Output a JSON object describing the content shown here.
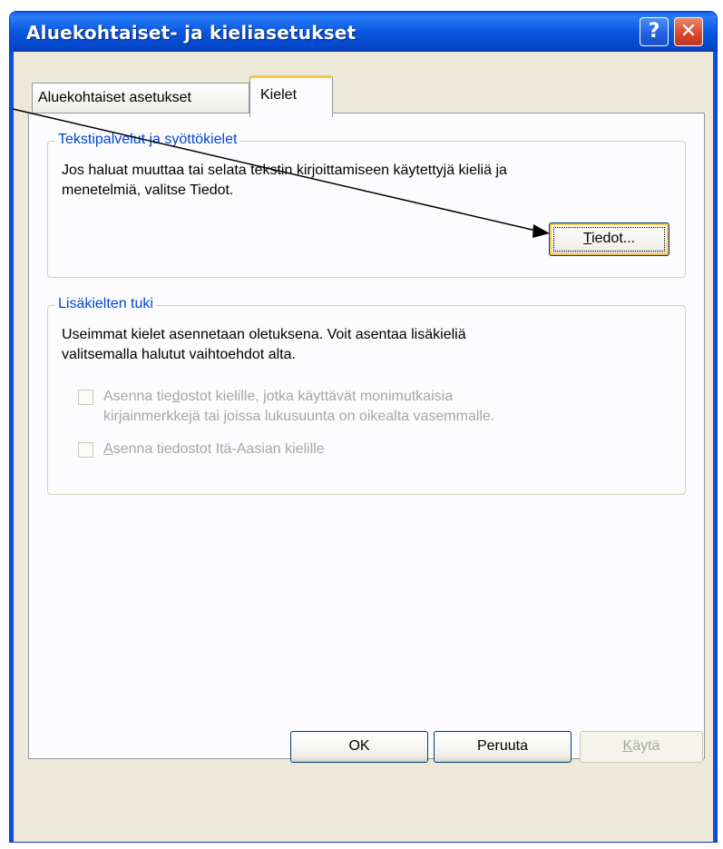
{
  "window": {
    "title": "Aluekohtaiset- ja kieliasetukset",
    "help_glyph": "?",
    "close_glyph": "✕"
  },
  "tabs": [
    {
      "label": "Aluekohtaiset asetukset",
      "active": false
    },
    {
      "label": "Kielet",
      "active": true
    }
  ],
  "text_services": {
    "group_label": "Tekstipalvelut ja syöttökielet",
    "description_line1": "Jos haluat muuttaa tai selata tekstin kirjoittamiseen käytettyjä kieliä ja",
    "description_line2": "menetelmiä, valitse Tiedot.",
    "details_button_accel": "T",
    "details_button_rest": "iedot..."
  },
  "supplemental": {
    "group_label": "Lisäkielten tuki",
    "description_line1": "Useimmat kielet asennetaan oletuksena. Voit asentaa lisäkieliä",
    "description_line2": "valitsemalla halutut vaihtoehdot alta.",
    "complex_script_line1_pre": "Asenna tie",
    "complex_script_line1_accel": "d",
    "complex_script_line1_post": "ostot kielille, jotka käyttävät monimutkaisia",
    "complex_script_line2": "kirjainmerkkejä tai joissa lukusuunta on oikealta vasemmalle.",
    "complex_script_checked": false,
    "east_asian_accel": "A",
    "east_asian_rest": "senna tiedostot Itä-Aasian kielille",
    "east_asian_checked": false
  },
  "buttons": {
    "ok": "OK",
    "cancel": "Peruuta",
    "apply_accel": "K",
    "apply_rest": "äytä"
  },
  "colors": {
    "title_bar": "#0a5fe8",
    "group_label": "#0046d5",
    "disabled_text": "#a6a6a6",
    "dialog_bg": "#ece9d8"
  }
}
